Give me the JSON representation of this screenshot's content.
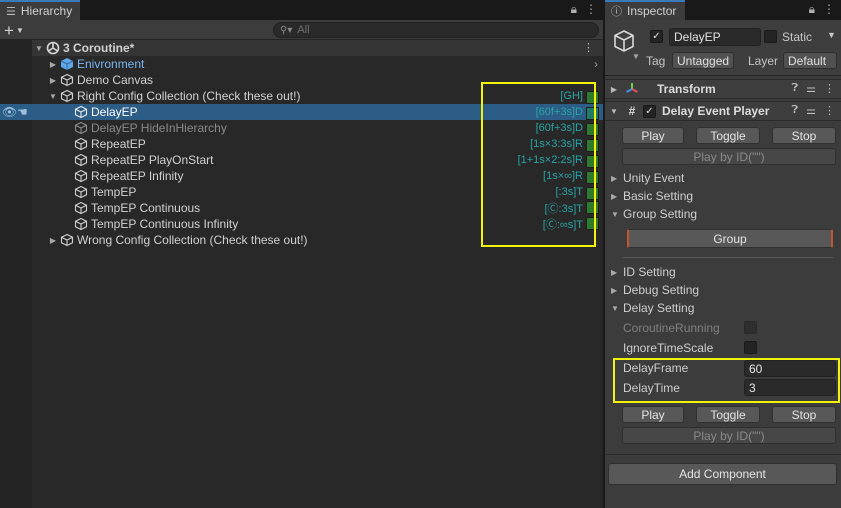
{
  "hierarchy": {
    "tab_title": "Hierarchy",
    "search_placeholder": "All",
    "scene_name": "3 Coroutine*",
    "items": [
      {
        "label": "Enivronment",
        "style": "blue",
        "arrow": "▶"
      },
      {
        "label": "Demo Canvas",
        "style": "normal",
        "arrow": "▶"
      },
      {
        "label": "Right Config Collection (Check these out!)",
        "style": "normal",
        "arrow": "▼"
      },
      {
        "label": "DelayEP",
        "style": "selected",
        "arrow": ""
      },
      {
        "label": "DelayEP HideInHierarchy",
        "style": "dim",
        "arrow": ""
      },
      {
        "label": "RepeatEP",
        "style": "normal",
        "arrow": ""
      },
      {
        "label": "RepeatEP PlayOnStart",
        "style": "normal",
        "arrow": ""
      },
      {
        "label": "RepeatEP Infinity",
        "style": "normal",
        "arrow": ""
      },
      {
        "label": "TempEP",
        "style": "normal",
        "arrow": ""
      },
      {
        "label": "TempEP Continuous",
        "style": "normal",
        "arrow": ""
      },
      {
        "label": "TempEP Continuous Infinity",
        "style": "normal",
        "arrow": ""
      },
      {
        "label": "Wrong Config Collection (Check these out!)",
        "style": "normal",
        "arrow": "▶"
      }
    ],
    "badges": [
      "[GH]",
      "[60f+3s]D",
      "[60f+3s]D",
      "[1s×3:3s]R",
      "[1+1s×2:2s]R",
      "[1s×∞]R",
      "[:3s]T",
      "[Ⓒ:3s]T",
      "[Ⓒ:∞s]T"
    ],
    "highlight_color": "#f2f20a",
    "selection_color": "#2c5d87",
    "icons": {
      "add": "plus-icon",
      "lock": "lock-icon",
      "menu": "kebab-menu-icon",
      "search": "search-icon",
      "scene": "unity-scene-icon",
      "object": "cube-icon"
    }
  },
  "inspector": {
    "tab_title": "Inspector",
    "object_name": "DelayEP",
    "static_label": "Static",
    "tag_label": "Tag",
    "tag_value": "Untagged",
    "layer_label": "Layer",
    "layer_value": "Default",
    "transform_title": "Transform",
    "component_title": "Delay Event Player",
    "buttons": {
      "play": "Play",
      "toggle": "Toggle",
      "stop": "Stop",
      "play_by_id": "Play by ID(\"\")"
    },
    "folds": {
      "unity_event": "Unity Event",
      "basic_setting": "Basic Setting",
      "group_setting": "Group Setting",
      "id_setting": "ID Setting",
      "debug_setting": "Debug Setting",
      "delay_setting": "Delay Setting"
    },
    "group_button": "Group",
    "props": {
      "coroutine_running": "CoroutineRunning",
      "ignore_timescale": "IgnoreTimeScale",
      "delay_frame_label": "DelayFrame",
      "delay_frame_value": "60",
      "delay_time_label": "DelayTime",
      "delay_time_value": "3"
    },
    "add_component": "Add Component"
  }
}
